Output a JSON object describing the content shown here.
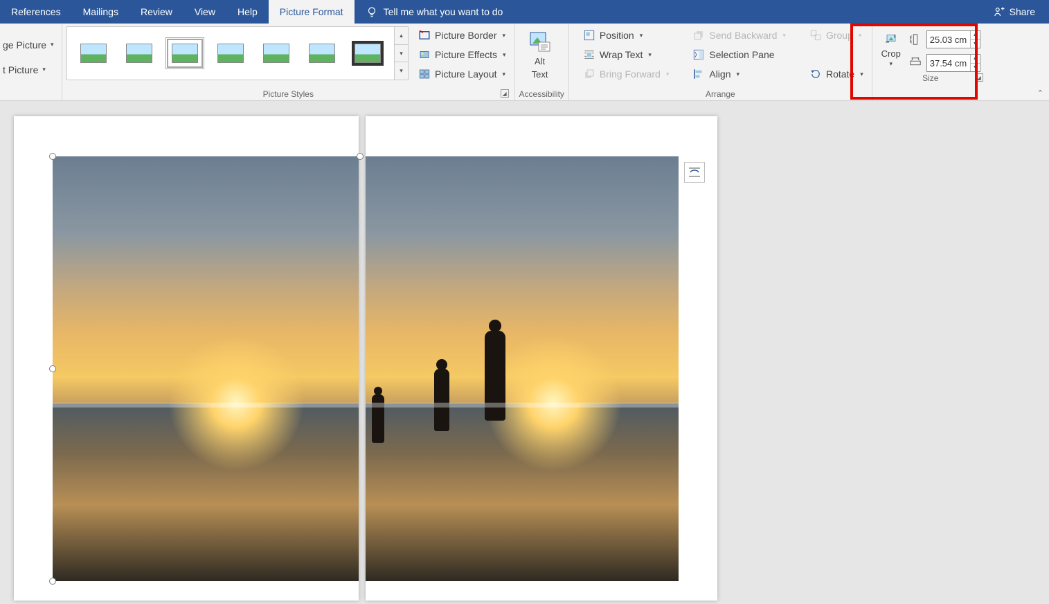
{
  "tabs": {
    "references": "References",
    "mailings": "Mailings",
    "review": "Review",
    "view": "View",
    "help": "Help",
    "picture_format": "Picture Format"
  },
  "tellme_placeholder": "Tell me what you want to do",
  "share": "Share",
  "group_clip": {
    "change_picture": "ge Picture",
    "reset_picture": "t Picture"
  },
  "group_styles": {
    "label": "Picture Styles"
  },
  "picture": {
    "border": "Picture Border",
    "effects": "Picture Effects",
    "layout": "Picture Layout"
  },
  "accessibility": {
    "alt_text_line1": "Alt",
    "alt_text_line2": "Text",
    "label": "Accessibility"
  },
  "arrange": {
    "position": "Position",
    "wrap_text": "Wrap Text",
    "bring_forward": "Bring Forward",
    "send_backward": "Send Backward",
    "selection_pane": "Selection Pane",
    "align": "Align",
    "group": "Group",
    "rotate": "Rotate",
    "label": "Arrange"
  },
  "size": {
    "crop": "Crop",
    "height": "25.03 cm",
    "width": "37.54 cm",
    "label": "Size"
  }
}
